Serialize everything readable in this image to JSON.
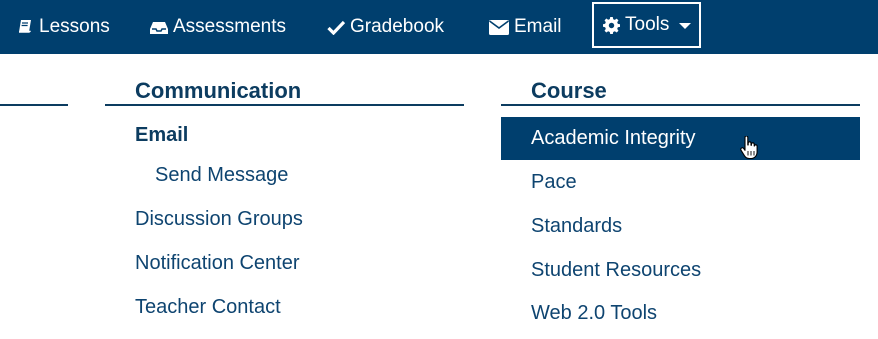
{
  "nav": {
    "lessons": "Lessons",
    "assessments": "Assessments",
    "gradebook": "Gradebook",
    "email": "Email",
    "tools": "Tools"
  },
  "communication": {
    "title": "Communication",
    "email_header": "Email",
    "send_message": "Send Message",
    "discussion_groups": "Discussion Groups",
    "notification_center": "Notification Center",
    "teacher_contact": "Teacher Contact"
  },
  "course": {
    "title": "Course",
    "items": [
      "Academic Integrity",
      "Pace",
      "Standards",
      "Student Resources",
      "Web 2.0 Tools"
    ]
  },
  "colors": {
    "nav_bg": "#003f6e",
    "heading": "#0c3c60",
    "link": "#0e4470",
    "highlight": "#003f6e"
  },
  "icons": [
    "book-icon",
    "inbox-icon",
    "checkmark-icon",
    "envelope-icon",
    "gear-icon",
    "caret-down-icon",
    "hand-pointer-cursor-icon"
  ]
}
